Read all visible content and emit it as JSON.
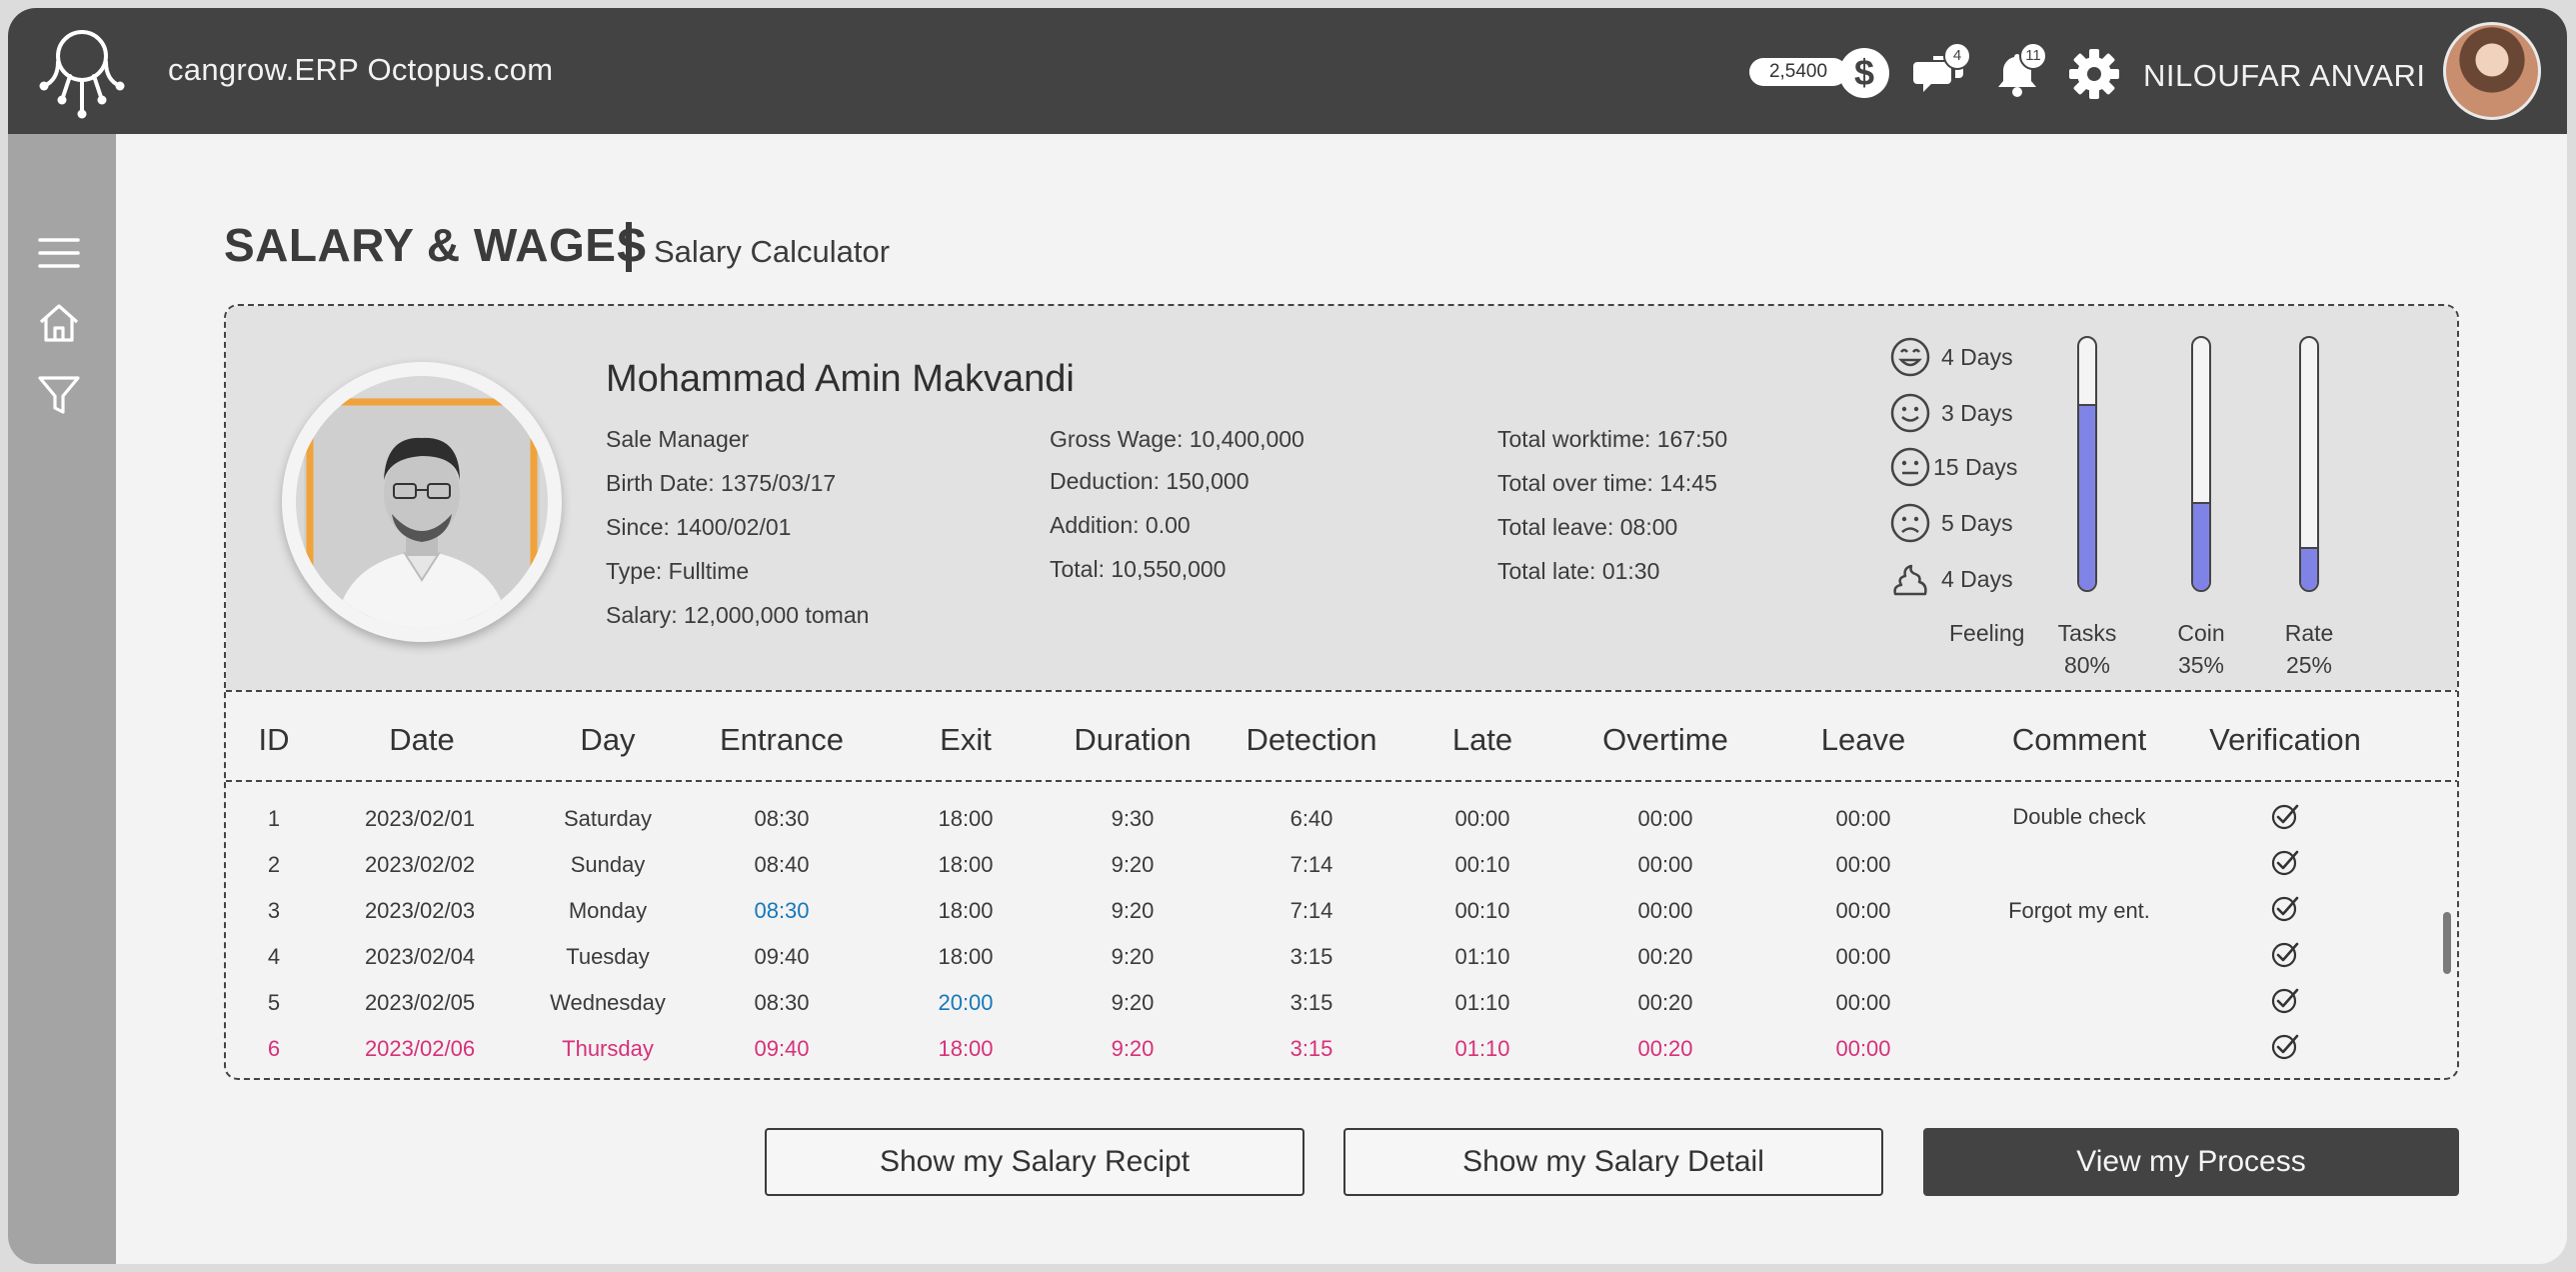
{
  "app": {
    "title": "cangrow.ERP Octopus.com"
  },
  "topbar": {
    "coin_balance": "2,5400",
    "messages_badge": "4",
    "notifications_badge": "11",
    "user_name": "NILOUFAR ANVARI"
  },
  "page": {
    "title": "SALARY & WAGES",
    "subtitle": "Salary Calculator"
  },
  "employee": {
    "name": "Mohammad Amin Makvandi",
    "role": "Sale Manager",
    "birth_date": "Birth Date: 1375/03/17",
    "since": "Since: 1400/02/01",
    "type": "Type: Fulltime",
    "salary": "Salary: 12,000,000 toman"
  },
  "wages": {
    "gross": "Gross Wage: 10,400,000",
    "deduction": "Deduction:  150,000",
    "addition": "Addition:  0.00",
    "total": "Total:  10,550,000"
  },
  "times": {
    "worktime": "Total worktime: 167:50",
    "overtime": "Total over time:  14:45",
    "leave": "Total leave:  08:00",
    "late": "Total late:  01:30"
  },
  "feelings": {
    "label": "Feeling",
    "items": [
      {
        "icon": "very-happy-face-icon",
        "days": "4 Days"
      },
      {
        "icon": "happy-face-icon",
        "days": "3 Days"
      },
      {
        "icon": "neutral-face-icon",
        "days": "15 Days"
      },
      {
        "icon": "sad-face-icon",
        "days": "5 Days"
      },
      {
        "icon": "poop-icon",
        "days": "4 Days"
      }
    ]
  },
  "meters": [
    {
      "label": "Tasks",
      "percent_text": "80%",
      "value": 0.74
    },
    {
      "label": "Coin",
      "percent_text": "35%",
      "value": 0.35
    },
    {
      "label": "Rate",
      "percent_text": "25%",
      "value": 0.17
    }
  ],
  "table": {
    "columns": [
      "ID",
      "Date",
      "Day",
      "Entrance",
      "Exit",
      "Duration",
      "Detection",
      "Late",
      "Overtime",
      "Leave",
      "Comment",
      "Verification"
    ],
    "rows": [
      {
        "id": "1",
        "date": "2023/02/01",
        "day": "Saturday",
        "entrance": "08:30",
        "exit": "18:00",
        "duration": "9:30",
        "detection": "6:40",
        "late": "00:00",
        "overtime": "00:00",
        "leave": "00:00",
        "comment": "Double check",
        "verified": true
      },
      {
        "id": "2",
        "date": "2023/02/02",
        "day": "Sunday",
        "entrance": "08:40",
        "exit": "18:00",
        "duration": "9:20",
        "detection": "7:14",
        "late": "00:10",
        "overtime": "00:00",
        "leave": "00:00",
        "comment": "",
        "verified": true
      },
      {
        "id": "3",
        "date": "2023/02/03",
        "day": "Monday",
        "entrance": "08:30",
        "exit": "18:00",
        "duration": "9:20",
        "detection": "7:14",
        "late": "00:10",
        "overtime": "00:00",
        "leave": "00:00",
        "comment": "Forgot my ent.",
        "verified": true
      },
      {
        "id": "4",
        "date": "2023/02/04",
        "day": "Tuesday",
        "entrance": "09:40",
        "exit": "18:00",
        "duration": "9:20",
        "detection": "3:15",
        "late": "01:10",
        "overtime": "00:20",
        "leave": "00:00",
        "comment": "",
        "verified": true
      },
      {
        "id": "5",
        "date": "2023/02/05",
        "day": "Wednesday",
        "entrance": "08:30",
        "exit": "20:00",
        "duration": "9:20",
        "detection": "3:15",
        "late": "01:10",
        "overtime": "00:20",
        "leave": "00:00",
        "comment": "",
        "verified": true
      },
      {
        "id": "6",
        "date": "2023/02/06",
        "day": "Thursday",
        "entrance": "09:40",
        "exit": "18:00",
        "duration": "9:20",
        "detection": "3:15",
        "late": "01:10",
        "overtime": "00:20",
        "leave": "00:00",
        "comment": "",
        "verified": true
      }
    ]
  },
  "buttons": {
    "salary_receipt": "Show my Salary Recipt",
    "salary_detail": "Show my Salary Detail",
    "view_process": "View my Process"
  },
  "colors": {
    "topbar": "#434343",
    "sidebar": "#a4a4a4",
    "meter_fill": "#7f83e6",
    "highlight_row": "#d6317a",
    "edited_time": "#1778b8"
  }
}
